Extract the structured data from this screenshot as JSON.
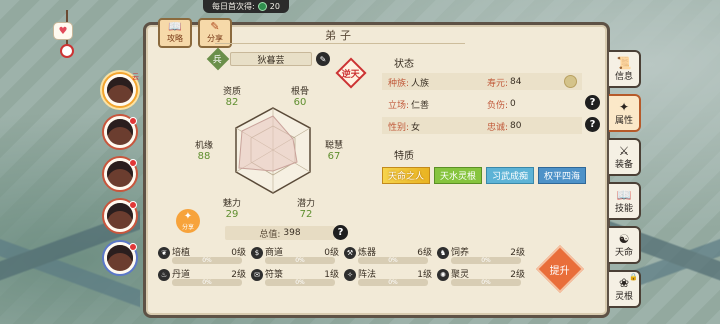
{
  "daily": {
    "label": "每日首次得:",
    "amount": "20"
  },
  "header": {
    "title": "弟子",
    "tab_attack": "攻略",
    "tab_share": "分享"
  },
  "disciple_list": [
    {
      "badge": "云"
    },
    {
      "badge": ""
    },
    {
      "badge": ""
    },
    {
      "badge": ""
    },
    {
      "badge": ""
    }
  ],
  "profile": {
    "name": "狄暮芸",
    "rank_glyph": "兵",
    "talent_badge": "逆天",
    "stats": {
      "zizhi": {
        "label": "资质",
        "value": "82"
      },
      "gengu": {
        "label": "根骨",
        "value": "60"
      },
      "jiyuan": {
        "label": "机缘",
        "value": "88"
      },
      "conghui": {
        "label": "聪慧",
        "value": "67"
      },
      "meili": {
        "label": "魅力",
        "value": "29"
      },
      "qianli": {
        "label": "潜力",
        "value": "72"
      }
    },
    "total_label": "总值:",
    "total_value": "398",
    "share_label": "分享"
  },
  "status": {
    "title": "状态",
    "rows": [
      {
        "k": "种族:",
        "v": "人族"
      },
      {
        "k": "寿元:",
        "v": "84"
      },
      {
        "k": "立场:",
        "v": "仁善"
      },
      {
        "k": "负伤:",
        "v": "0"
      },
      {
        "k": "性别:",
        "v": "女"
      },
      {
        "k": "忠诚:",
        "v": "80"
      }
    ]
  },
  "traits": {
    "title": "特质",
    "items": [
      "天命之人",
      "天水灵根",
      "习武成痴",
      "权平四海"
    ]
  },
  "skills": [
    {
      "name": "培植",
      "level": "0级",
      "progress": "0%"
    },
    {
      "name": "商道",
      "level": "0级",
      "progress": "0%"
    },
    {
      "name": "炼器",
      "level": "6级",
      "progress": "0%"
    },
    {
      "name": "饲养",
      "level": "2级",
      "progress": "0%"
    },
    {
      "name": "丹道",
      "level": "2级",
      "progress": "0%"
    },
    {
      "name": "符箓",
      "level": "1级",
      "progress": "0%"
    },
    {
      "name": "阵法",
      "level": "1级",
      "progress": "0%"
    },
    {
      "name": "聚灵",
      "level": "2级",
      "progress": "0%"
    }
  ],
  "promote_label": "提升",
  "side_tabs": [
    {
      "label": "信息",
      "glyph": "📜"
    },
    {
      "label": "属性",
      "glyph": "✦"
    },
    {
      "label": "装备",
      "glyph": "⚔"
    },
    {
      "label": "技能",
      "glyph": "📖"
    },
    {
      "label": "天命",
      "glyph": "☯"
    },
    {
      "label": "灵根",
      "glyph": "❀"
    }
  ],
  "help_glyph": "?",
  "heart_glyph": "♥"
}
